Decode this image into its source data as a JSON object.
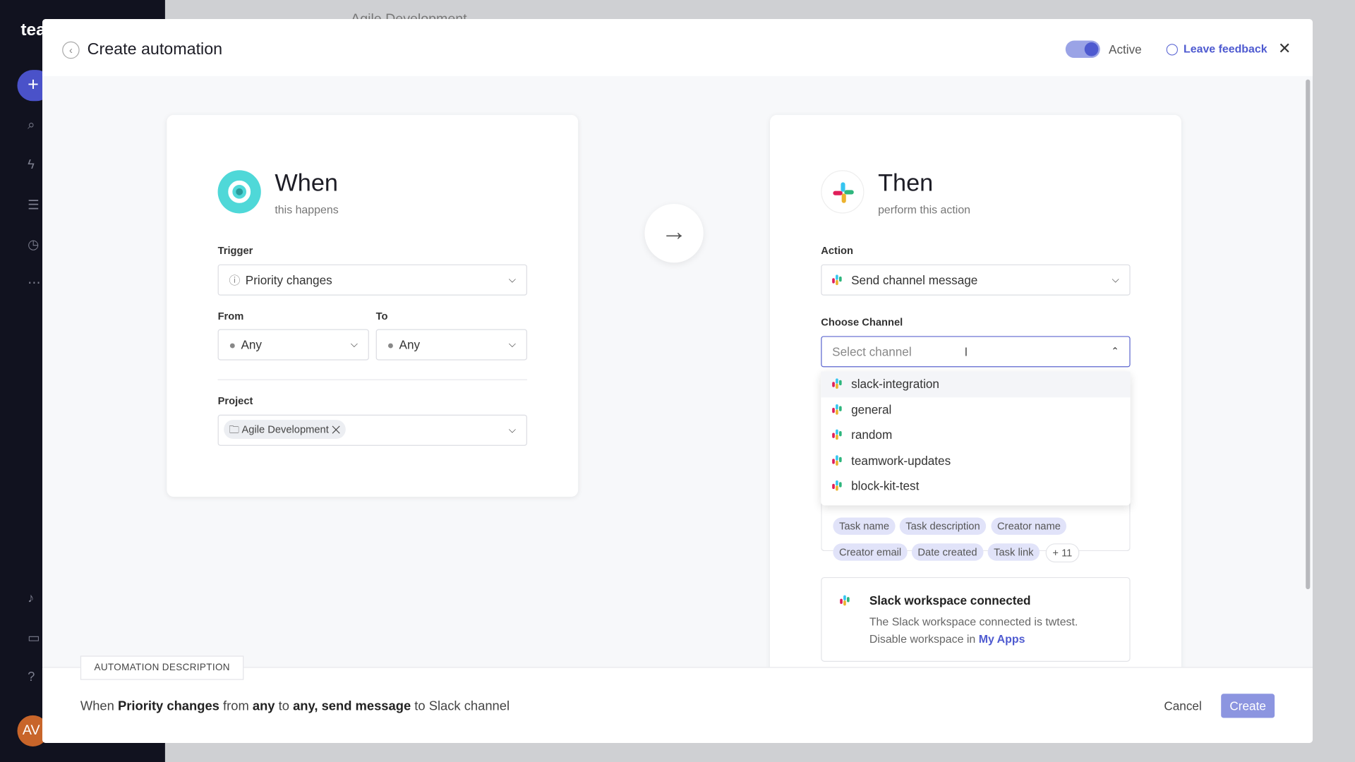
{
  "background": {
    "logo": "tea",
    "page_title": "Agile Development",
    "avatar": "AV"
  },
  "modal": {
    "title": "Create automation",
    "active_label": "Active",
    "active": true,
    "feedback": "Leave feedback"
  },
  "when": {
    "title": "When",
    "subtitle": "this happens",
    "trigger_label": "Trigger",
    "trigger_value": "Priority changes",
    "from_label": "From",
    "from_value": "Any",
    "to_label": "To",
    "to_value": "Any",
    "project_label": "Project",
    "project_value": "Agile Development"
  },
  "then": {
    "title": "Then",
    "subtitle": "perform this action",
    "action_label": "Action",
    "action_value": "Send channel message",
    "channel_label": "Choose Channel",
    "channel_placeholder": "Select channel",
    "channels": [
      "slack-integration",
      "general",
      "random",
      "teamwork-updates",
      "block-kit-test"
    ],
    "tags": [
      "Task name",
      "Task description",
      "Creator name",
      "Creator email",
      "Date created",
      "Task link",
      "+ 11"
    ],
    "slack_title": "Slack workspace connected",
    "slack_text": "The Slack workspace connected is twtest.",
    "slack_text2": "Disable workspace in",
    "slack_link": "My Apps"
  },
  "footer": {
    "desc_label": "AUTOMATION DESCRIPTION",
    "s1": "When",
    "s2": "Priority changes",
    "s3": "from",
    "s4": "any",
    "s5": "to",
    "s6": "any,",
    "s7": "send message",
    "s8": "to Slack channel",
    "cancel": "Cancel",
    "create": "Create"
  },
  "colors": {
    "accent": "#4e5ad0",
    "when_icon": "#4fd8d8"
  }
}
